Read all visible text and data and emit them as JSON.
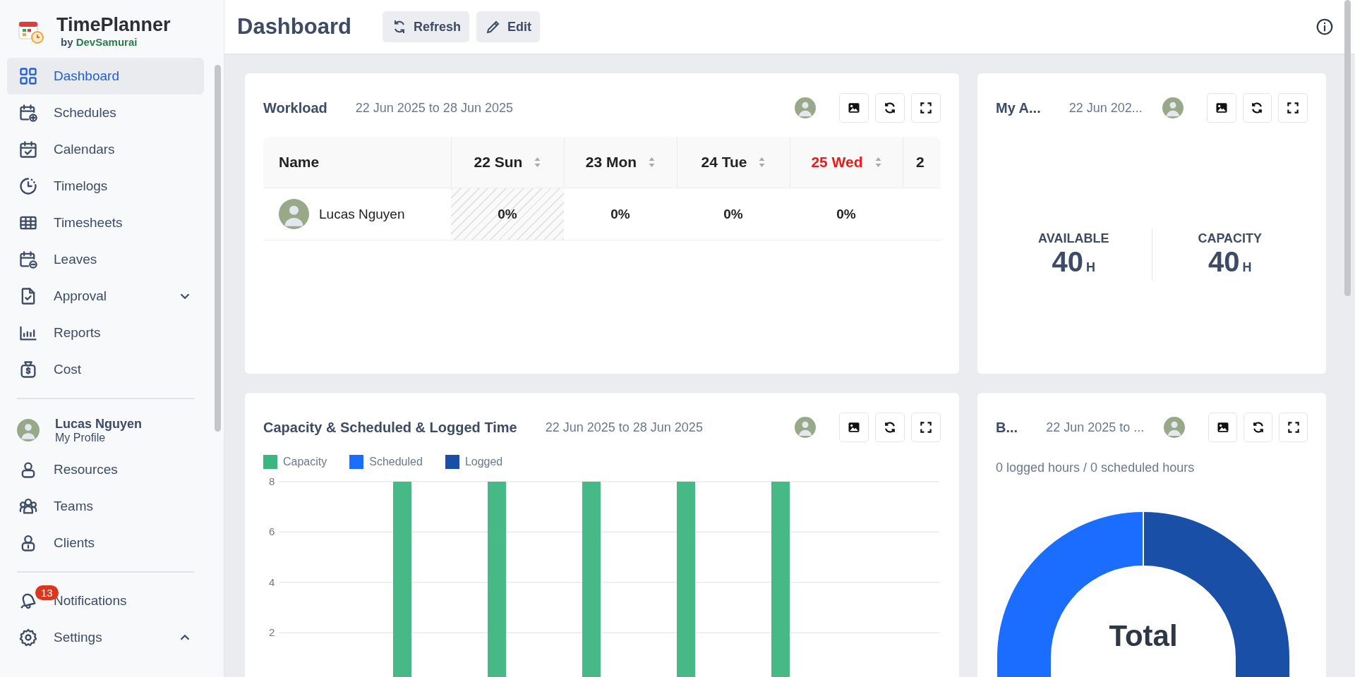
{
  "app": {
    "name": "TimePlanner",
    "by": "by",
    "vendor": "DevSamurai"
  },
  "sidebar": {
    "nav": [
      {
        "label": "Dashboard",
        "selected": true
      },
      {
        "label": "Schedules",
        "selected": false
      },
      {
        "label": "Calendars",
        "selected": false
      },
      {
        "label": "Timelogs",
        "selected": false
      },
      {
        "label": "Timesheets",
        "selected": false
      },
      {
        "label": "Leaves",
        "selected": false
      },
      {
        "label": "Approval",
        "selected": false,
        "expanded": false
      },
      {
        "label": "Reports",
        "selected": false
      },
      {
        "label": "Cost",
        "selected": false
      }
    ],
    "profile": {
      "name": "Lucas Nguyen",
      "link": "My Profile"
    },
    "people_nav": [
      {
        "label": "Resources",
        "selected": false
      },
      {
        "label": "Teams",
        "selected": false
      },
      {
        "label": "Clients",
        "selected": false
      }
    ],
    "bottom_nav": [
      {
        "label": "Notifications",
        "selected": false,
        "badge": "13"
      },
      {
        "label": "Settings",
        "selected": false,
        "expanded": true
      }
    ]
  },
  "header": {
    "title": "Dashboard",
    "buttons": [
      {
        "label": "Refresh"
      },
      {
        "label": "Edit"
      }
    ]
  },
  "workload": {
    "title": "Workload",
    "range": "22 Jun 2025 to 28 Jun 2025",
    "table": {
      "columns": [
        {
          "label": "Name",
          "kind": "name"
        },
        {
          "label": "22 Sun",
          "kind": "day",
          "today": false,
          "weekend": true
        },
        {
          "label": "23 Mon",
          "kind": "day",
          "today": false,
          "weekend": false
        },
        {
          "label": "24 Tue",
          "kind": "day",
          "today": false,
          "weekend": false
        },
        {
          "label": "25 Wed",
          "kind": "day",
          "today": true,
          "weekend": false
        },
        {
          "label": "2",
          "kind": "partial"
        }
      ],
      "rows": [
        {
          "cells": [
            "Lucas Nguyen",
            "0%",
            "0%",
            "0%",
            "0%"
          ]
        }
      ]
    }
  },
  "availability": {
    "title": "My A...",
    "range": "22 Jun 202...",
    "stats": [
      {
        "label": "AVAILABLE",
        "value": "40",
        "unit": "H"
      },
      {
        "label": "CAPACITY",
        "value": "40",
        "unit": "H"
      }
    ]
  },
  "capacity_chart": {
    "title": "Capacity & Scheduled & Logged Time",
    "range": "22 Jun 2025 to 28 Jun 2025",
    "chart_data": {
      "type": "bar",
      "grid": true,
      "ylim": [
        0,
        8
      ],
      "yticks": [
        2,
        4,
        6,
        8
      ],
      "series": [
        {
          "name": "Capacity",
          "color": "#3db580",
          "values": [
            0,
            8,
            8,
            8,
            8,
            8,
            0
          ]
        },
        {
          "name": "Scheduled",
          "color": "#1a6dff",
          "values": [
            0,
            0,
            0,
            0,
            0,
            0,
            0
          ]
        },
        {
          "name": "Logged",
          "color": "#1a4fa8",
          "values": [
            0,
            0,
            0,
            0,
            0,
            0,
            0
          ]
        }
      ]
    }
  },
  "burn": {
    "title": "B...",
    "range": "22 Jun 2025 to ...",
    "summary": "0 logged hours / 0 scheduled hours",
    "total_label": "Total"
  }
}
